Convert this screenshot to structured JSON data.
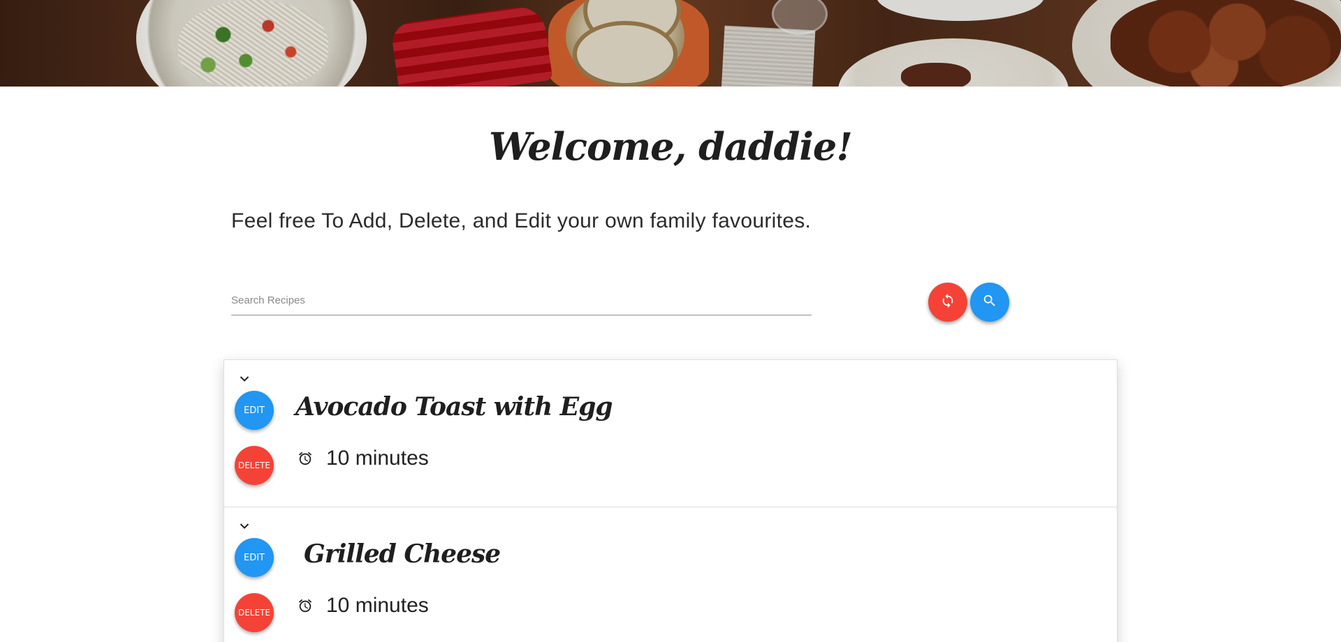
{
  "header": {
    "welcome": "Welcome, daddie!",
    "subtitle": "Feel free To Add, Delete, and Edit your own family favourites."
  },
  "search": {
    "placeholder": "Search Recipes",
    "reset_icon": "refresh-icon",
    "search_icon": "search-icon"
  },
  "recipes": [
    {
      "name": "Avocado Toast with Egg",
      "time": "10 minutes",
      "edit_label": "EDIT",
      "delete_label": "DELETE"
    },
    {
      "name": "Grilled Cheese",
      "time": "10 minutes",
      "edit_label": "EDIT",
      "delete_label": "DELETE"
    }
  ],
  "colors": {
    "primary_blue": "#2196f3",
    "danger_red": "#f44336",
    "text_dark": "#1f1f1f"
  }
}
